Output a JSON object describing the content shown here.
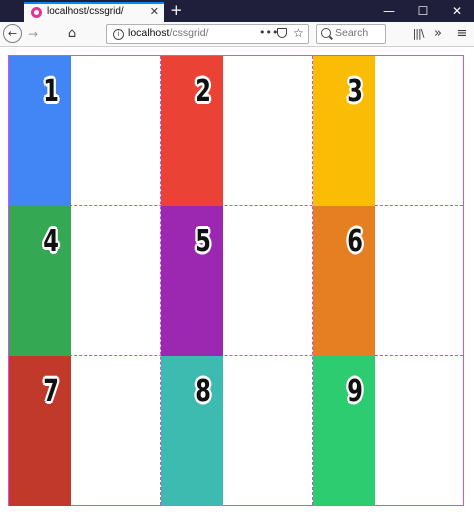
{
  "browser": {
    "tab": {
      "title": "localhost/cssgrid/",
      "close_glyph": "✕",
      "favicon": "firefox-dev-icon"
    },
    "new_tab_glyph": "+",
    "window_controls": {
      "minimize": "—",
      "maximize": "☐",
      "close": "✕"
    },
    "nav": {
      "back_glyph": "←",
      "forward_glyph": "→",
      "home_glyph": "⌂",
      "url_host": "localhost",
      "url_path": "/cssgrid/",
      "page_actions_glyph": "•••",
      "star_glyph": "☆",
      "search_placeholder": "Search",
      "library_glyph": "|||\\",
      "overflow_glyph": "»",
      "menu_glyph": "≡"
    }
  },
  "grid": {
    "border_color": "#d650e8",
    "items": [
      {
        "label": "1",
        "color": "#4285f4"
      },
      {
        "label": "2",
        "color": "#ea4335"
      },
      {
        "label": "3",
        "color": "#fbbc05"
      },
      {
        "label": "4",
        "color": "#34a853"
      },
      {
        "label": "5",
        "color": "#9c27b0"
      },
      {
        "label": "6",
        "color": "#e67e22"
      },
      {
        "label": "7",
        "color": "#c0392b"
      },
      {
        "label": "8",
        "color": "#3dbbb0"
      },
      {
        "label": "9",
        "color": "#2ecc71"
      }
    ]
  }
}
